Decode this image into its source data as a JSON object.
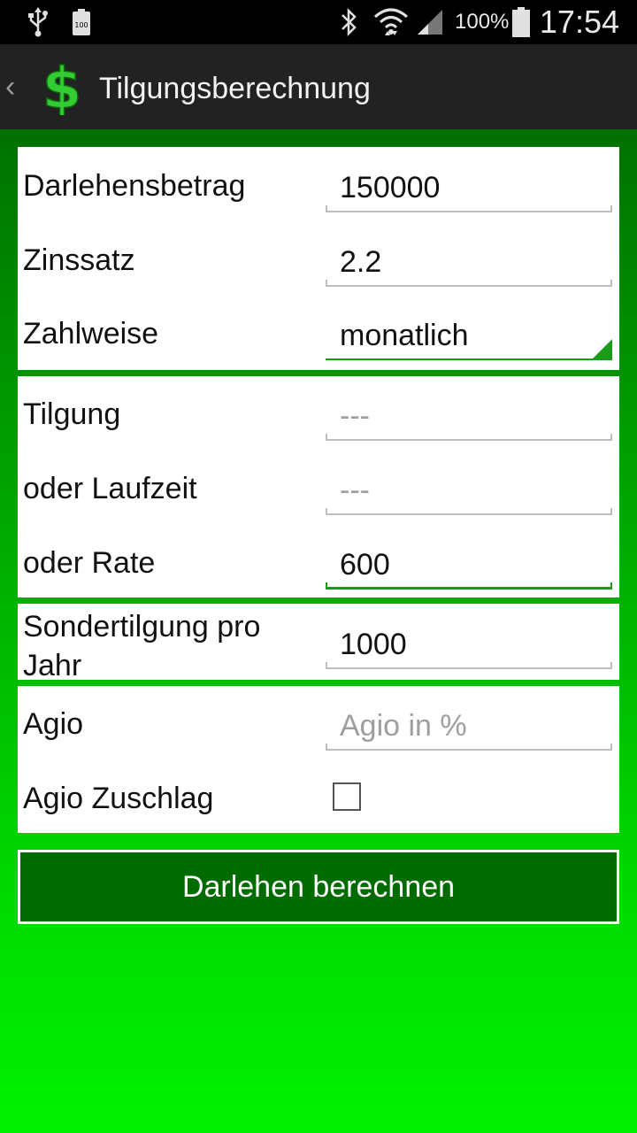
{
  "status_bar": {
    "time": "17:54",
    "battery_percent": "100%",
    "icons": [
      "usb-icon",
      "battery-full-small-icon",
      "bluetooth-icon",
      "wifi-icon",
      "signal-icon",
      "battery-icon"
    ],
    "small_battery_text": "100"
  },
  "action_bar": {
    "title": "Tilgungsberechnung",
    "back_glyph": "‹",
    "app_icon_glyph": "$"
  },
  "panel1": {
    "darlehensbetrag": {
      "label": "Darlehensbetrag",
      "value": "150000"
    },
    "zinssatz": {
      "label": "Zinssatz",
      "value": "2.2"
    },
    "zahlweise": {
      "label": "Zahlweise",
      "value": "monatlich"
    }
  },
  "panel2": {
    "tilgung": {
      "label": "Tilgung",
      "placeholder": "---"
    },
    "laufzeit": {
      "label": "oder Laufzeit",
      "placeholder": "---"
    },
    "rate": {
      "label": "oder Rate",
      "value": "600"
    }
  },
  "panel3": {
    "sondertilgung": {
      "label_line1": "Sondertilgung pro",
      "label_line2": "Jahr",
      "value": "1000"
    }
  },
  "panel4": {
    "agio": {
      "label": "Agio",
      "placeholder": "Agio in %"
    },
    "agio_zuschlag": {
      "label": "Agio Zuschlag",
      "checked": false
    }
  },
  "calculate_button": {
    "label": "Darlehen berechnen"
  },
  "colors": {
    "accent": "#1a9b1a",
    "button_bg": "#006c00",
    "action_bar_bg": "#222222"
  }
}
